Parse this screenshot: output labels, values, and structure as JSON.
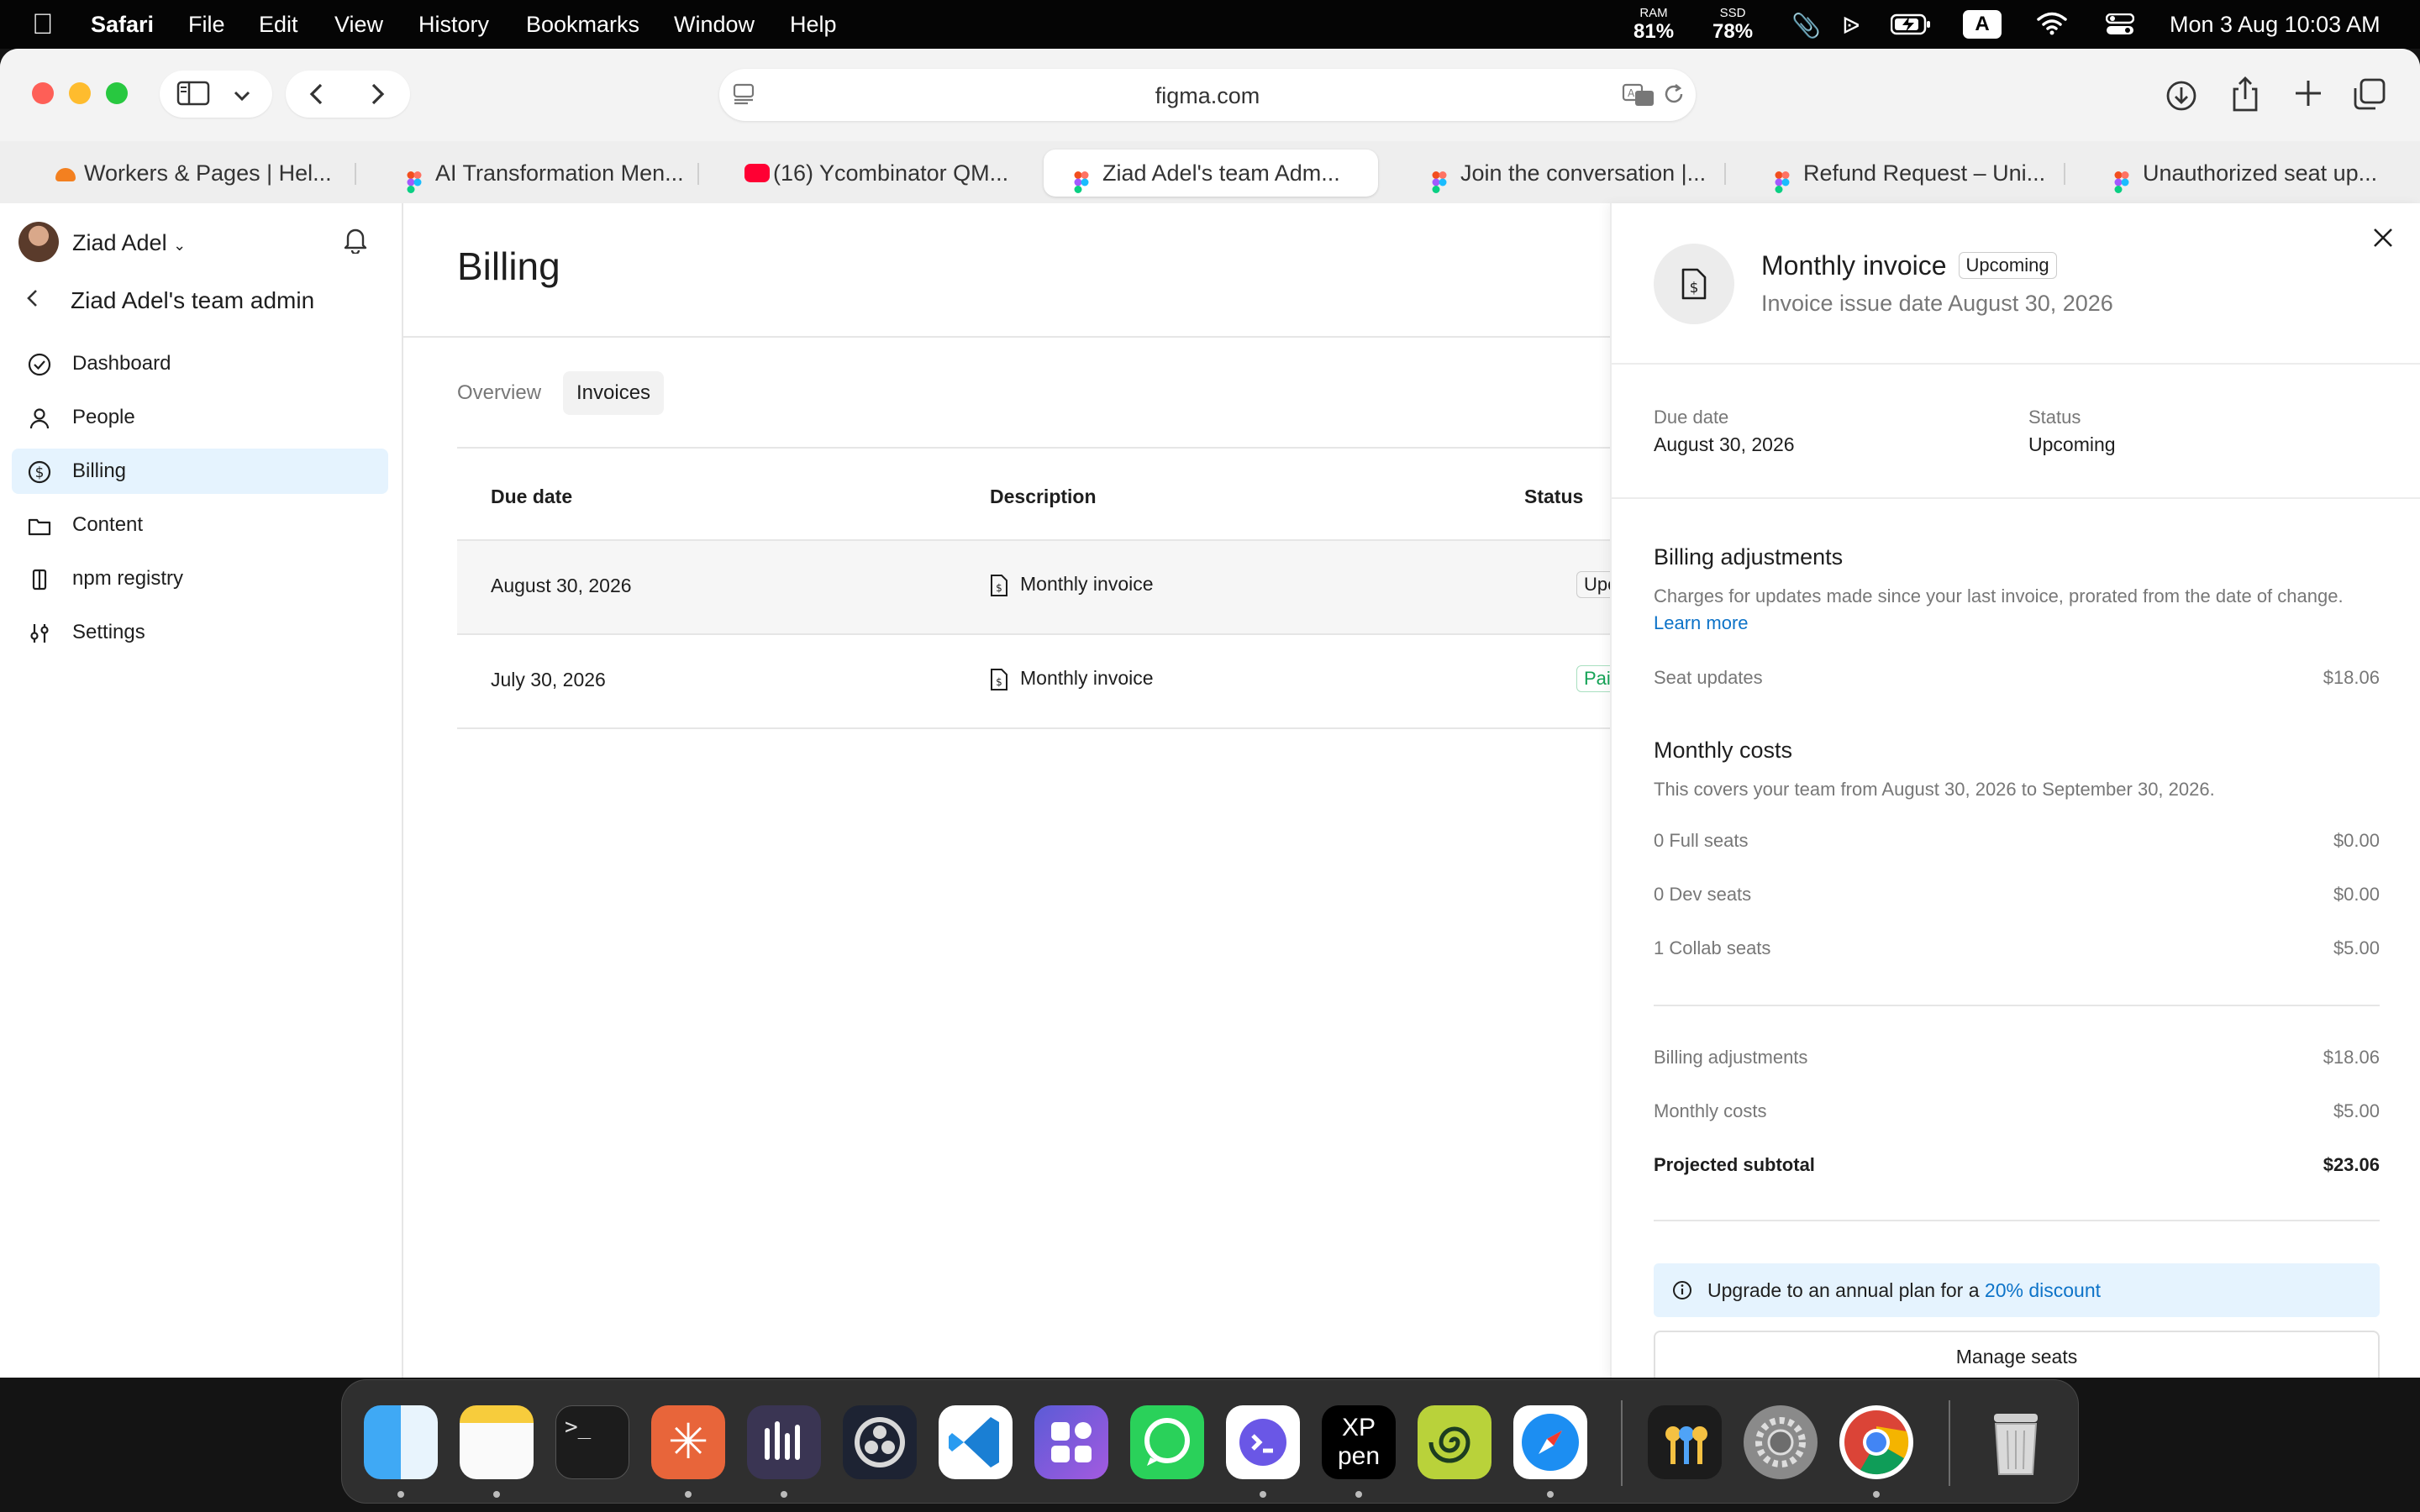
{
  "menubar": {
    "apple_icon": "apple-logo",
    "app": "Safari",
    "menus": [
      "File",
      "Edit",
      "View",
      "History",
      "Bookmarks",
      "Window",
      "Help"
    ],
    "ram_label": "RAM",
    "ram_value": "81%",
    "ssd_label": "SSD",
    "ssd_value": "78%",
    "input_badge": "A",
    "clock": "Mon 3 Aug  10:03 AM"
  },
  "browser": {
    "url": "figma.com",
    "tabs": [
      {
        "title": "Workers & Pages | Hel...",
        "color": "#f38020"
      },
      {
        "title": "AI Transformation Men...",
        "color": "#a259ff"
      },
      {
        "title": "(16) Ycombinator QM...",
        "color": "#ff0033"
      },
      {
        "title": "Ziad Adel's team Adm...",
        "color": "#a259ff"
      },
      {
        "title": "Join the conversation |...",
        "color": "#a259ff"
      },
      {
        "title": "Refund Request – Uni...",
        "color": "#a259ff"
      },
      {
        "title": "Unauthorized seat up...",
        "color": "#a259ff"
      }
    ]
  },
  "sidebar": {
    "user_name": "Ziad Adel",
    "team_title": "Ziad Adel's team admin",
    "items": [
      {
        "label": "Dashboard",
        "icon": "check-circle-icon"
      },
      {
        "label": "People",
        "icon": "person-icon"
      },
      {
        "label": "Billing",
        "icon": "dollar-circle-icon"
      },
      {
        "label": "Content",
        "icon": "folder-icon"
      },
      {
        "label": "npm registry",
        "icon": "package-icon"
      },
      {
        "label": "Settings",
        "icon": "sliders-icon"
      }
    ]
  },
  "main": {
    "title": "Billing",
    "tabs": [
      "Overview",
      "Invoices"
    ],
    "columns": [
      "Due date",
      "Description",
      "Status"
    ],
    "rows": [
      {
        "date": "August 30, 2026",
        "description": "Monthly invoice",
        "status": "Upcoming"
      },
      {
        "date": "July 30, 2026",
        "description": "Monthly invoice",
        "status": "Paid"
      }
    ]
  },
  "panel": {
    "title": "Monthly invoice",
    "badge": "Upcoming",
    "subtitle": "Invoice issue date August 30, 2026",
    "due_label": "Due date",
    "due_value": "August 30, 2026",
    "status_label": "Status",
    "status_value": "Upcoming",
    "adj_heading": "Billing adjustments",
    "adj_desc": "Charges for updates made since your last invoice, prorated from the date of change.",
    "adj_link": "Learn more",
    "adj_items": [
      {
        "label": "Seat updates",
        "amount": "$18.06"
      }
    ],
    "monthly_heading": "Monthly costs",
    "monthly_desc": "This covers your team from August 30, 2026 to September 30, 2026.",
    "monthly_items": [
      {
        "label": "0 Full seats",
        "amount": "$0.00"
      },
      {
        "label": "0 Dev seats",
        "amount": "$0.00"
      },
      {
        "label": "1 Collab seats",
        "amount": "$5.00"
      }
    ],
    "summary": [
      {
        "label": "Billing adjustments",
        "amount": "$18.06"
      },
      {
        "label": "Monthly costs",
        "amount": "$5.00"
      }
    ],
    "total_label": "Projected subtotal",
    "total_amount": "$23.06",
    "upgrade_text": "Upgrade to an annual plan for a ",
    "upgrade_link": "20% discount",
    "manage_button": "Manage seats"
  },
  "dock": {
    "apps": [
      "Finder",
      "Notes",
      "Terminal",
      "Claude",
      "Audio app",
      "OBS Studio",
      "Visual Studio Code",
      "Shortcuts",
      "WhatsApp",
      "Terminal client",
      "XPPen",
      "Spiral app",
      "Safari",
      "Passwords",
      "System Settings",
      "Google Chrome",
      "Trash"
    ]
  }
}
